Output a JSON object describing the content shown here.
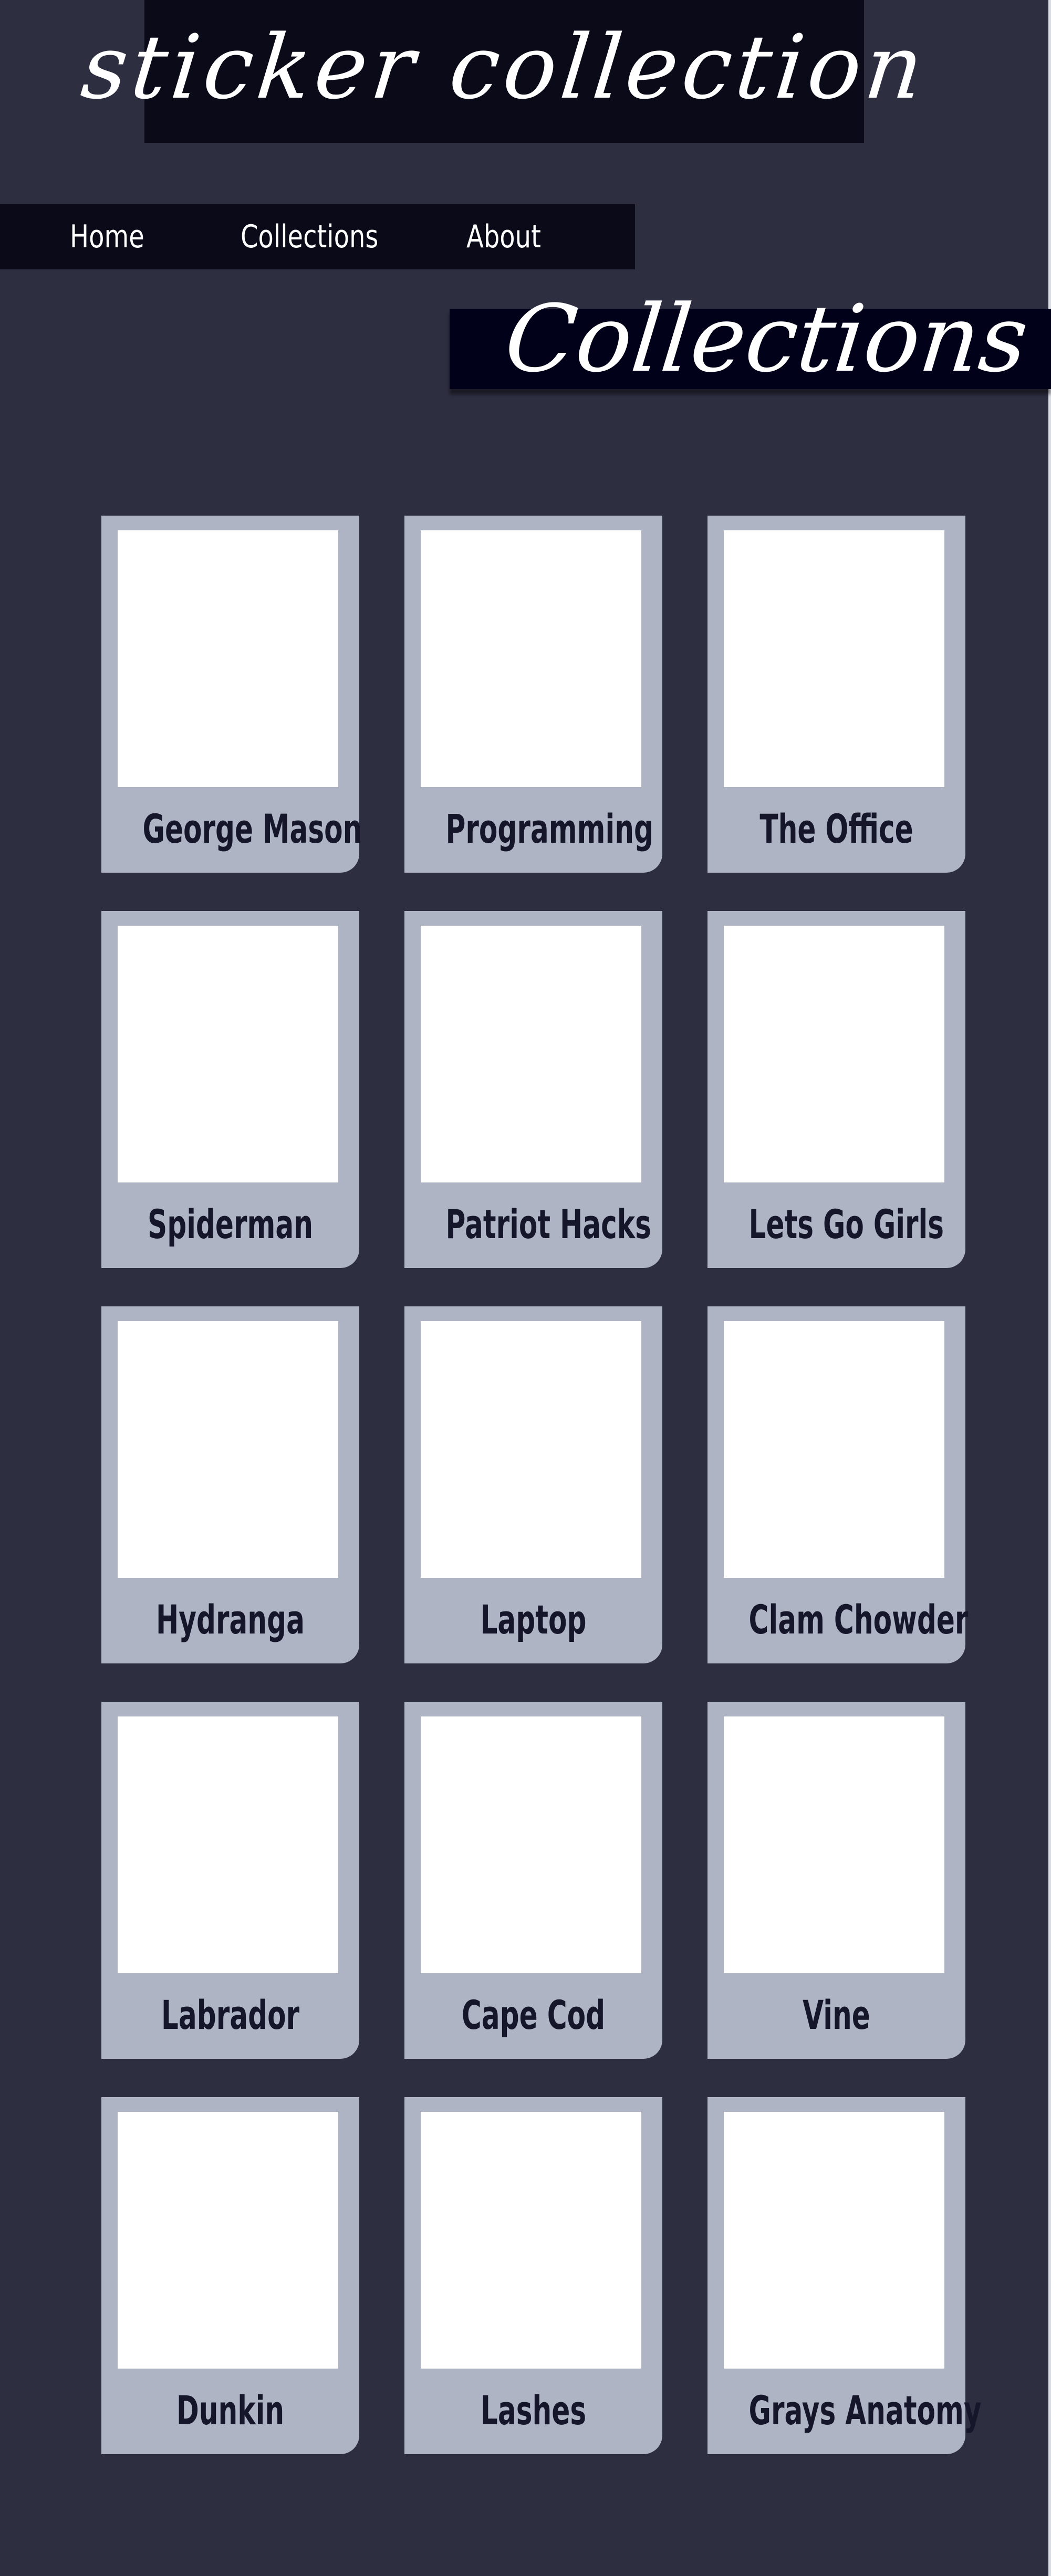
{
  "site": {
    "title": "sticker collection"
  },
  "nav": {
    "items": [
      {
        "label": "Home"
      },
      {
        "label": "Collections"
      },
      {
        "label": "About"
      }
    ]
  },
  "section": {
    "title": "Collections"
  },
  "cards": [
    {
      "label": "George Mason"
    },
    {
      "label": "Programming"
    },
    {
      "label": "The Office"
    },
    {
      "label": "Spiderman"
    },
    {
      "label": "Patriot Hacks"
    },
    {
      "label": "Lets Go Girls"
    },
    {
      "label": "Hydranga"
    },
    {
      "label": "Laptop"
    },
    {
      "label": "Clam Chowder"
    },
    {
      "label": "Labrador"
    },
    {
      "label": "Cape Cod"
    },
    {
      "label": "Vine"
    },
    {
      "label": "Dunkin"
    },
    {
      "label": "Lashes"
    },
    {
      "label": "Grays Anatomy"
    }
  ],
  "colors": {
    "background": "#2d2e40",
    "header": "#0a0a18",
    "card": "#aeb4c3",
    "card_image": "#ffffff",
    "card_text": "#15162a"
  }
}
